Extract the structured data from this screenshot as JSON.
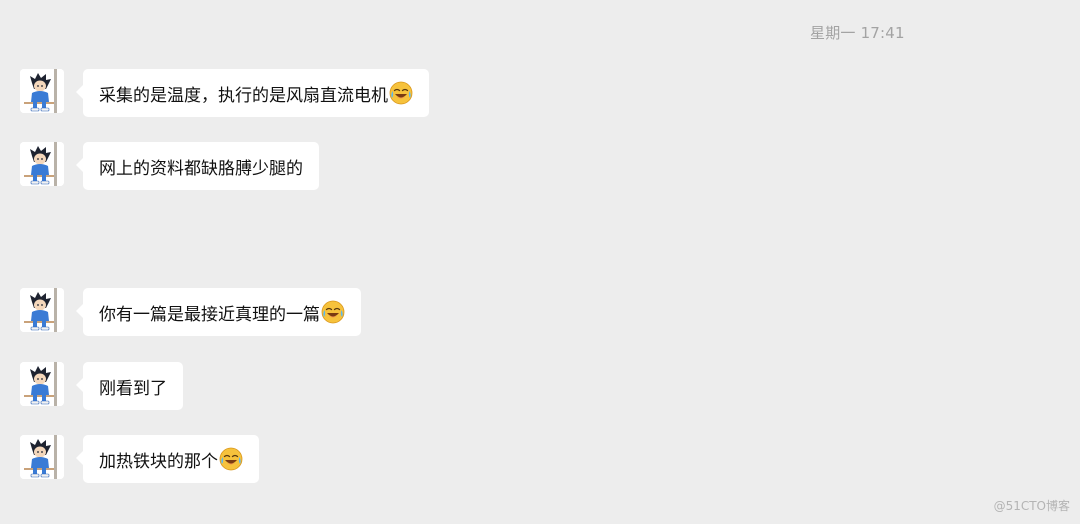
{
  "timestamp": "星期一 17:41",
  "messages": [
    {
      "text": "采集的是温度，执行的是风扇直流电机",
      "emoji": "laughing-crying-emoji"
    },
    {
      "text": "网上的资料都缺胳膊少腿的",
      "emoji": ""
    },
    {
      "text": "你有一篇是最接近真理的一篇",
      "emoji": "laughing-crying-emoji"
    },
    {
      "text": "刚看到了",
      "emoji": ""
    },
    {
      "text": "加热铁块的那个",
      "emoji": "laughing-crying-emoji"
    }
  ],
  "avatar_icon": "cartoon-boy-avatar",
  "watermark": "@51CTO博客",
  "colors": {
    "background": "#ededed",
    "bubble": "#ffffff",
    "text": "#111111",
    "timestamp": "#a3a3a3"
  }
}
